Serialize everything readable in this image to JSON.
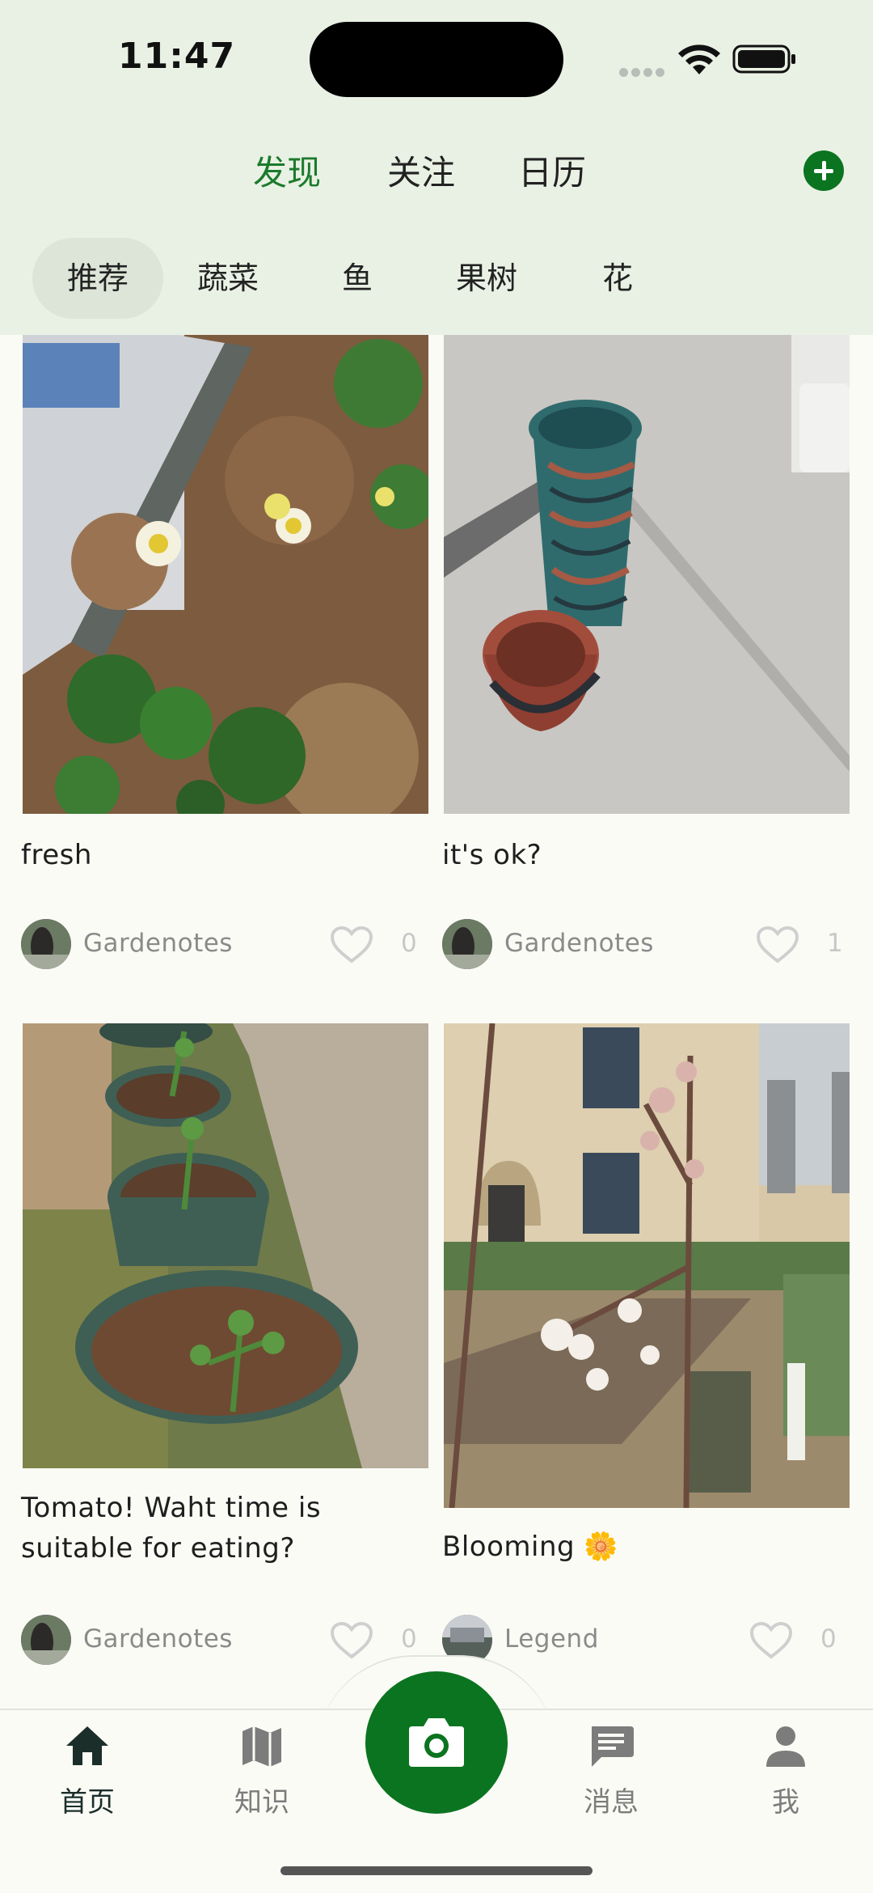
{
  "status_bar": {
    "time": "11:47"
  },
  "header": {
    "tabs": [
      {
        "label": "发现",
        "active": true
      },
      {
        "label": "关注",
        "active": false
      },
      {
        "label": "日历",
        "active": false
      }
    ],
    "categories": [
      {
        "label": "推荐",
        "active": true
      },
      {
        "label": "蔬菜",
        "active": false
      },
      {
        "label": "鱼",
        "active": false
      },
      {
        "label": "果树",
        "active": false
      },
      {
        "label": "花",
        "active": false
      }
    ]
  },
  "feed": [
    {
      "title": "fresh",
      "author": "Gardenotes",
      "likes": "0"
    },
    {
      "title": "it's ok?",
      "author": "Gardenotes",
      "likes": "1"
    },
    {
      "title": "Tomato! Waht time is suitable for eating?",
      "author": "Gardenotes",
      "likes": "0"
    },
    {
      "title": "Blooming 🌼",
      "author": "Legend",
      "likes": "0"
    }
  ],
  "bottom_nav": [
    {
      "label": "首页",
      "icon": "home-icon",
      "active": true
    },
    {
      "label": "知识",
      "icon": "map-icon",
      "active": false
    },
    {
      "label": "消息",
      "icon": "message-icon",
      "active": false
    },
    {
      "label": "我",
      "icon": "person-icon",
      "active": false
    }
  ],
  "colors": {
    "brand_green": "#0b7420",
    "header_bg": "#e9f1e4",
    "active_tab": "#1c7a2c"
  }
}
